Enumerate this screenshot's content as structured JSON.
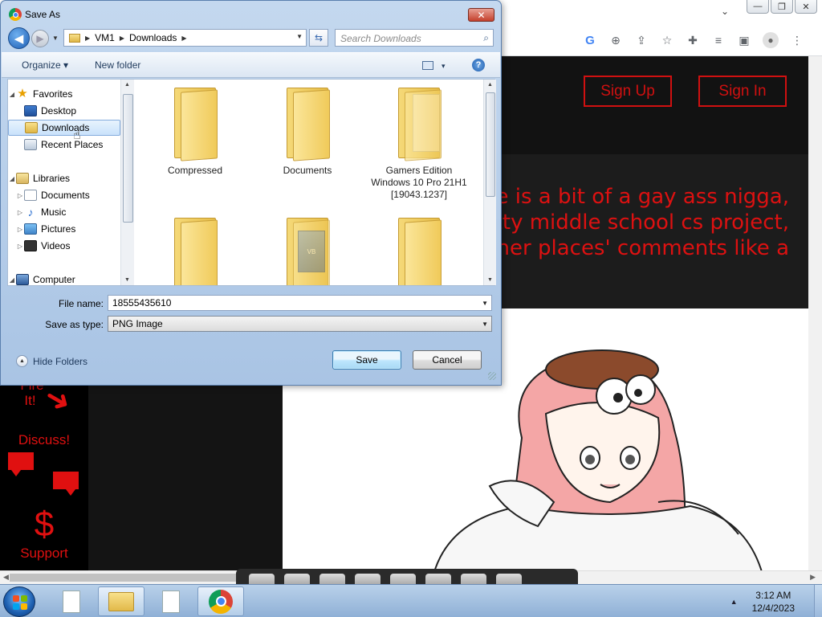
{
  "browser": {
    "tab_dropdown": "⌄",
    "controls": {
      "minimize": "—",
      "restore": "❐",
      "close": "✕"
    },
    "toolbar_icons": [
      "google-icon",
      "zoom-icon",
      "share-icon",
      "bookmark-star-icon",
      "extensions-icon",
      "media-icon",
      "sidepanel-icon",
      "profile-icon",
      "menu-icon"
    ]
  },
  "site": {
    "signup_label": "Sign Up",
    "signin_label": "Sign In",
    "banner_lines": [
      "site is a bit of a gay ass nigga,",
      "hitty middle school cs project,",
      "other places' comments like a"
    ],
    "left_nav": {
      "fire_label_1": "Fire",
      "fire_label_2": "It!",
      "discuss_label": "Discuss!",
      "dollar_glyph": "$",
      "support_label": "Support"
    },
    "accent_color": "#e01010"
  },
  "dialog": {
    "title": "Save As",
    "close_glyph": "✕",
    "breadcrumb": [
      "VM1",
      "Downloads"
    ],
    "search_placeholder": "Search Downloads",
    "organize_label": "Organize ▾",
    "new_folder_label": "New folder",
    "view_dropdown": "▾",
    "help_glyph": "?",
    "nav_pane": {
      "favorites": "Favorites",
      "desktop": "Desktop",
      "downloads": "Downloads",
      "recent_places": "Recent Places",
      "libraries": "Libraries",
      "documents": "Documents",
      "music": "Music",
      "pictures": "Pictures",
      "videos": "Videos",
      "computer": "Computer"
    },
    "folders": [
      {
        "name": "Compressed"
      },
      {
        "name": "Documents"
      },
      {
        "name": "Gamers Edition Windows 10 Pro 21H1 [19043.1237]"
      },
      {
        "name": ""
      },
      {
        "name": ""
      },
      {
        "name": ""
      }
    ],
    "file_name_label": "File name:",
    "file_name_value": "18555435610",
    "save_type_label": "Save as type:",
    "save_type_value": "PNG Image",
    "hide_folders_label": "Hide Folders",
    "save_label": "Save",
    "cancel_label": "Cancel"
  },
  "taskbar": {
    "clock_time": "3:12 AM",
    "clock_date": "12/4/2023",
    "tray_arrow": "▲"
  }
}
